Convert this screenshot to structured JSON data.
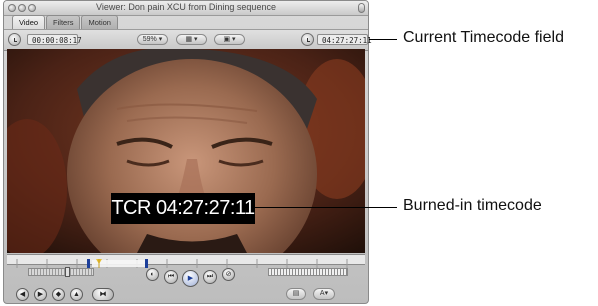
{
  "window": {
    "title": "Viewer: Don pain XCU from Dining sequence"
  },
  "tabs": [
    {
      "label": "Video"
    },
    {
      "label": "Filters"
    },
    {
      "label": "Motion"
    }
  ],
  "toolbar": {
    "duration_timecode": "00:00:08:17",
    "zoom_value": "59%",
    "view_menu_label": "",
    "current_timecode": "04:27:27:11"
  },
  "video": {
    "burned_in_timecode": "TCR 04:27:27:11"
  },
  "callouts": {
    "current_timecode_field": "Current Timecode field",
    "burned_in_timecode": "Burned-in timecode"
  },
  "colors": {
    "accent_blue": "#1d3f9a",
    "window_bg": "#c8c8c8"
  }
}
